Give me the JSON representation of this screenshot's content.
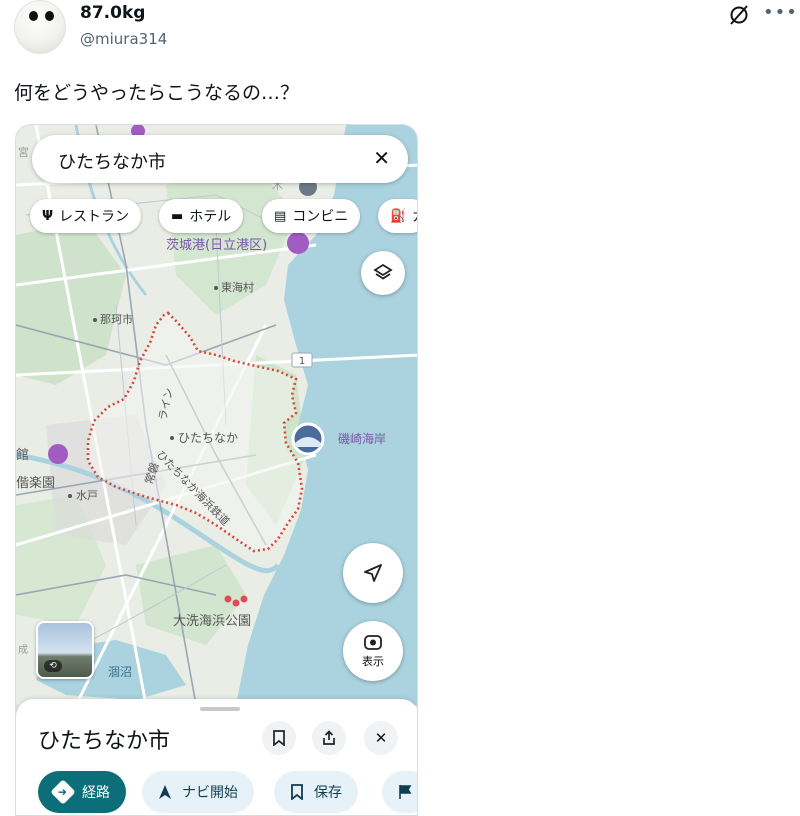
{
  "tweet": {
    "display_name": "87.0kg",
    "handle": "@miura314",
    "text": "何をどうやったらこうなるの…？",
    "icons": [
      "grok-icon",
      "more-icon"
    ]
  },
  "maps": {
    "search": {
      "query": "ひたちなか市"
    },
    "chips": [
      {
        "icon": "restaurant-icon",
        "label": "レストラン"
      },
      {
        "icon": "hotel-icon",
        "label": "ホテル"
      },
      {
        "icon": "convenience-store-icon",
        "label": "コンビニ"
      },
      {
        "icon": "gas-station-icon",
        "label": "ガ"
      }
    ],
    "labels": {
      "port": "茨城港(日立港区)",
      "tokai": "東海村",
      "naka": "那珂市",
      "hitachinaka": "ひたちなか",
      "isozaki": "磯崎海岸",
      "mito": "水戸",
      "oarai": "大洗海浜公園",
      "hinuma": "涸沼",
      "kan": "館",
      "rakuen": "偕楽園",
      "rail_upper": "ライン",
      "rail_lower": "ひたちなか海浜鉄道",
      "road": "常磐",
      "route_shield": "1",
      "narita": "成",
      "miya": "宮",
      "ki": "木"
    },
    "layers_icon": "layers-icon",
    "locate_icon": "navigation-arrow-icon",
    "lens_label": "表示",
    "place": {
      "name": "ひたちなか市",
      "actions": [
        "経路",
        "ナビ開始",
        "保存"
      ]
    },
    "colors": {
      "sea": "#aad3df",
      "land": "#e8ece4",
      "boundary": "#d44a3b",
      "primary_button": "#0b6e78",
      "poi": "#a15cc2"
    }
  }
}
